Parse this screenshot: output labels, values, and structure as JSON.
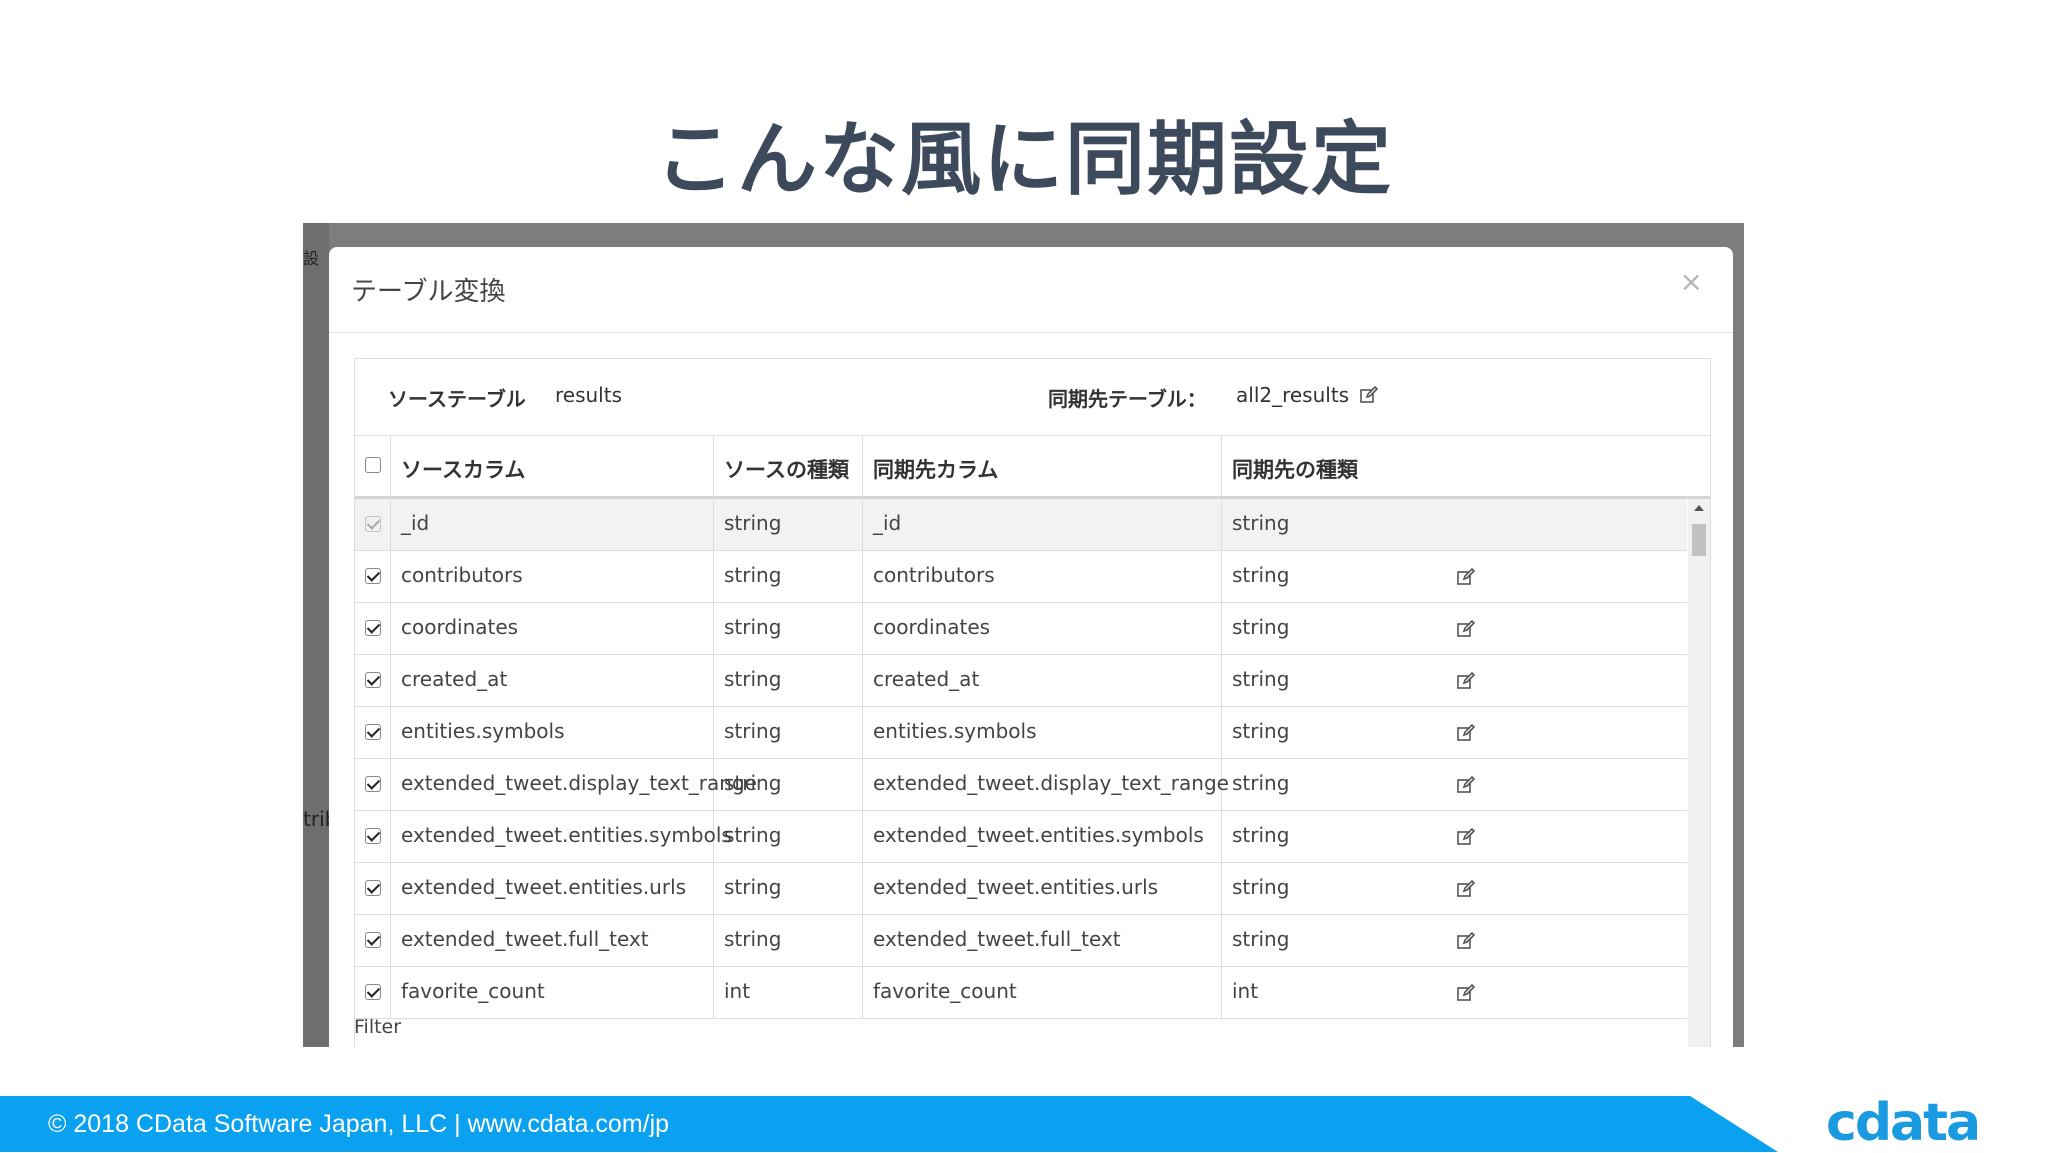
{
  "slide": {
    "title": "こんな風に同期設定",
    "footer_text": "© 2018 CData Software Japan, LLC | www.cdata.com/jp",
    "logo_text": "cdata",
    "accent_color": "#0aa1f0"
  },
  "background": {
    "glyph1": "設",
    "glyph2": "trib"
  },
  "modal": {
    "title": "テーブル変換",
    "close_label": "×",
    "source_table_label": "ソーステーブル",
    "source_table_value": "results",
    "dest_table_label": "同期先テーブル：",
    "dest_table_value": "all2_results",
    "filter_label": "Filter"
  },
  "grid": {
    "headers": {
      "source_column": "ソースカラム",
      "source_type": "ソースの種類",
      "dest_column": "同期先カラム",
      "dest_type": "同期先の種類"
    },
    "rows": [
      {
        "source": "_id",
        "source_type": "string",
        "dest": "_id",
        "dest_type": "string",
        "checked": true,
        "locked": true
      },
      {
        "source": "contributors",
        "source_type": "string",
        "dest": "contributors",
        "dest_type": "string",
        "checked": true,
        "locked": false
      },
      {
        "source": "coordinates",
        "source_type": "string",
        "dest": "coordinates",
        "dest_type": "string",
        "checked": true,
        "locked": false
      },
      {
        "source": "created_at",
        "source_type": "string",
        "dest": "created_at",
        "dest_type": "string",
        "checked": true,
        "locked": false
      },
      {
        "source": "entities.symbols",
        "source_type": "string",
        "dest": "entities.symbols",
        "dest_type": "string",
        "checked": true,
        "locked": false
      },
      {
        "source": "extended_tweet.display_text_range",
        "source_type": "string",
        "dest": "extended_tweet.display_text_range",
        "dest_type": "string",
        "checked": true,
        "locked": false
      },
      {
        "source": "extended_tweet.entities.symbols",
        "source_type": "string",
        "dest": "extended_tweet.entities.symbols",
        "dest_type": "string",
        "checked": true,
        "locked": false
      },
      {
        "source": "extended_tweet.entities.urls",
        "source_type": "string",
        "dest": "extended_tweet.entities.urls",
        "dest_type": "string",
        "checked": true,
        "locked": false
      },
      {
        "source": "extended_tweet.full_text",
        "source_type": "string",
        "dest": "extended_tweet.full_text",
        "dest_type": "string",
        "checked": true,
        "locked": false
      },
      {
        "source": "favorite_count",
        "source_type": "int",
        "dest": "favorite_count",
        "dest_type": "int",
        "checked": true,
        "locked": false
      }
    ]
  },
  "icons": {
    "edit": "edit-icon",
    "close": "close-icon",
    "scroll_up": "scroll-up-arrow-icon",
    "scroll_down": "scroll-down-arrow-icon"
  }
}
